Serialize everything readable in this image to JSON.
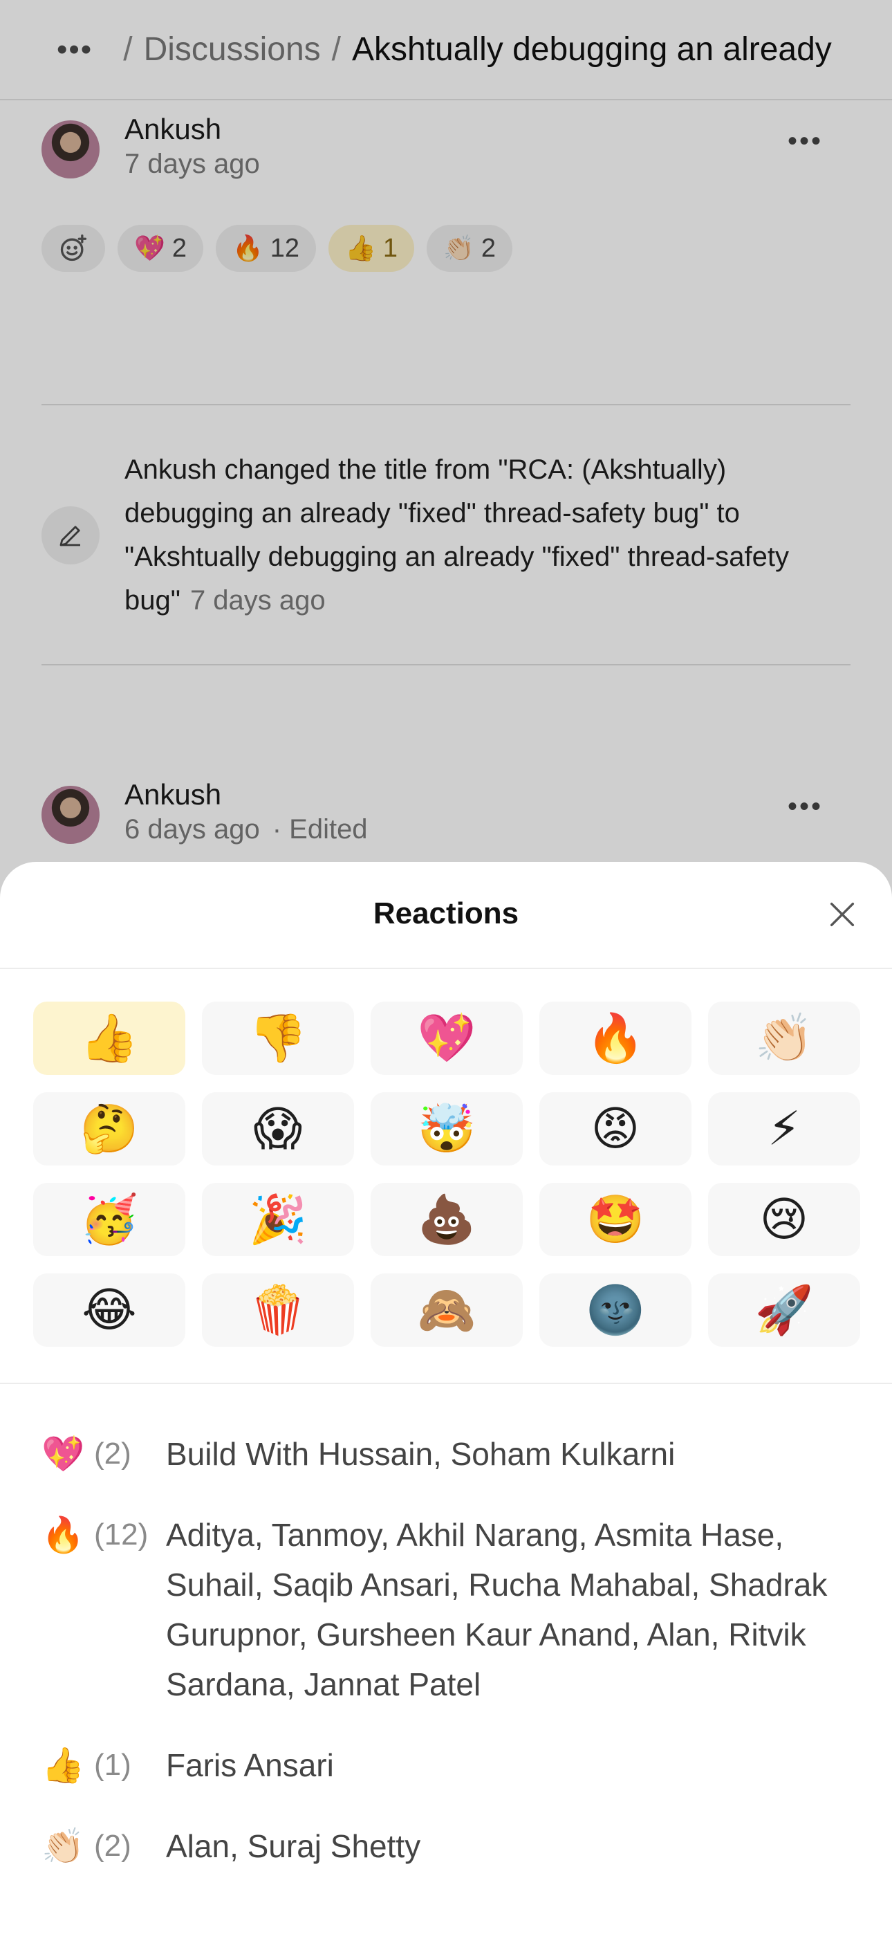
{
  "topbar": {
    "menu_icon": "ellipsis-icon",
    "crumb": "Discussions",
    "separator": "/",
    "current": "Akshtually debugging an already"
  },
  "post1": {
    "author": "Ankush",
    "time": "7 days ago",
    "reactions": [
      {
        "emoji": "💖",
        "count": "2",
        "active": false
      },
      {
        "emoji": "🔥",
        "count": "12",
        "active": false
      },
      {
        "emoji": "👍",
        "count": "1",
        "active": true
      },
      {
        "emoji": "👏🏻",
        "count": "2",
        "active": false
      }
    ]
  },
  "activity": {
    "text": "Ankush changed the title from \"RCA: (Akshtually) debugging an already \"fixed\" thread-safety bug\" to \"Akshtually debugging an already \"fixed\" thread-safety bug\"",
    "time": "7 days ago"
  },
  "post2": {
    "author": "Ankush",
    "time": "6 days ago",
    "edited": "· Edited"
  },
  "sheet": {
    "title": "Reactions",
    "emojis": [
      "👍",
      "👎",
      "💖",
      "🔥",
      "👏🏻",
      "🤔",
      "😱",
      "🤯",
      "😡",
      "⚡",
      "🥳",
      "🎉",
      "💩",
      "🤩",
      "😢",
      "😂",
      "🍿",
      "🙈",
      "🌚",
      "🚀"
    ],
    "selected_index": 0,
    "reactors": [
      {
        "emoji": "💖",
        "count": "(2)",
        "names": "Build With Hussain, Soham Kulkarni"
      },
      {
        "emoji": "🔥",
        "count": "(12)",
        "names": "Aditya, Tanmoy, Akhil Narang, Asmita Hase, Suhail, Saqib Ansari, Rucha Mahabal, Shadrak Gurupnor, Gursheen Kaur Anand, Alan, Ritvik Sardana, Jannat Patel"
      },
      {
        "emoji": "👍",
        "count": "(1)",
        "names": "Faris Ansari"
      },
      {
        "emoji": "👏🏻",
        "count": "(2)",
        "names": "Alan, Suraj Shetty"
      }
    ]
  },
  "colors": {
    "accent_bg": "#fdf4cf",
    "overlay": "rgba(0,0,0,0.19)"
  }
}
